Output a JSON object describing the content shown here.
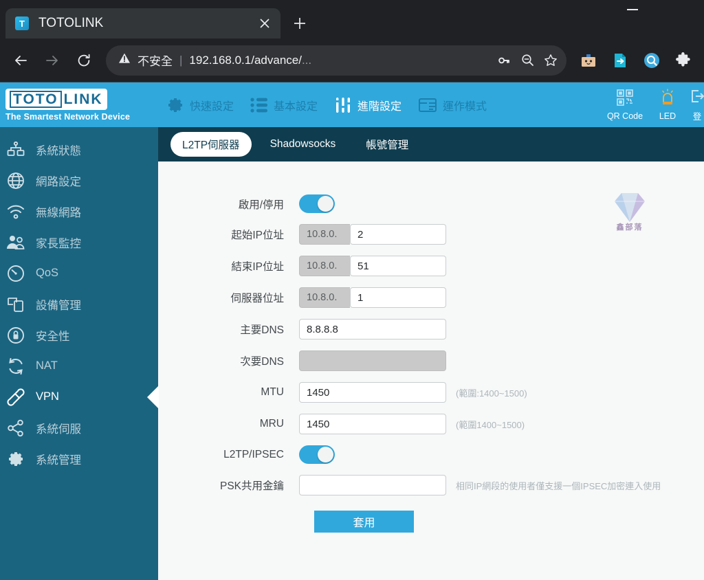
{
  "browser": {
    "tab": {
      "title": "TOTOLINK",
      "favicon": "T",
      "close_icon": "close-icon",
      "newtab_icon": "plus-icon"
    },
    "window": {
      "minimize_icon": "minimize-icon"
    },
    "toolbar": {
      "back_icon": "back-arrow-icon",
      "forward_icon": "forward-arrow-icon",
      "reload_icon": "reload-icon",
      "security_icon": "not-secure-warning-icon",
      "security_label": "不安全",
      "separator": "|",
      "url": "192.168.0.1/advance/",
      "url_tail": "...",
      "password_icon": "key-icon",
      "zoomout_icon": "zoom-out-icon",
      "bookmark_icon": "star-icon",
      "ext_icons": [
        "box-robot-extension-icon",
        "export-extension-icon",
        "search-magnifier-extension-icon",
        "puzzle-extensions-icon"
      ]
    }
  },
  "brand": {
    "logo_toto": "TOTO",
    "logo_link": "LINK",
    "tagline": "The Smartest Network Device"
  },
  "topnav": {
    "items": [
      {
        "label": "快速設定",
        "icon": "gear-icon",
        "active": false
      },
      {
        "label": "基本設定",
        "icon": "list-icon",
        "active": false
      },
      {
        "label": "進階設定",
        "icon": "sliders-icon",
        "active": true
      },
      {
        "label": "運作模式",
        "icon": "mode-window-icon",
        "active": false
      }
    ],
    "right_items": [
      {
        "label": "QR Code",
        "icon": "qr-code-icon"
      },
      {
        "label": "LED",
        "icon": "led-lamp-icon"
      },
      {
        "label": "登",
        "icon": "logout-icon"
      }
    ]
  },
  "sidebar": {
    "items": [
      {
        "label": "系統狀態",
        "icon": "network-status-icon",
        "active": false
      },
      {
        "label": "網路設定",
        "icon": "globe-icon",
        "active": false
      },
      {
        "label": "無線網路",
        "icon": "wifi-icon",
        "active": false
      },
      {
        "label": "家長監控",
        "icon": "parental-control-icon",
        "active": false
      },
      {
        "label": "QoS",
        "icon": "gauge-icon",
        "active": false
      },
      {
        "label": "設備管理",
        "icon": "devices-icon",
        "active": false
      },
      {
        "label": "安全性",
        "icon": "lock-icon",
        "active": false
      },
      {
        "label": "NAT",
        "icon": "refresh-cycle-icon",
        "active": false
      },
      {
        "label": "VPN",
        "icon": "key-chain-icon",
        "active": true
      },
      {
        "label": "系統伺服",
        "icon": "share-nodes-icon",
        "active": false
      },
      {
        "label": "系統管理",
        "icon": "gear-icon",
        "active": false
      }
    ]
  },
  "tabs": [
    {
      "label": "L2TP伺服器",
      "active": true
    },
    {
      "label": "Shadowsocks",
      "active": false
    },
    {
      "label": "帳號管理",
      "active": false
    }
  ],
  "form": {
    "enable": {
      "label": "啟用/停用",
      "state": "on"
    },
    "start_ip": {
      "label": "起始IP位址",
      "prefix": "10.8.0.",
      "value": "2"
    },
    "end_ip": {
      "label": "結束IP位址",
      "prefix": "10.8.0.",
      "value": "51"
    },
    "server_ip": {
      "label": "伺服器位址",
      "prefix": "10.8.0.",
      "value": "1"
    },
    "primary_dns": {
      "label": "主要DNS",
      "value": "8.8.8.8"
    },
    "secondary_dns": {
      "label": "次要DNS",
      "value": "",
      "disabled": true
    },
    "mtu": {
      "label": "MTU",
      "value": "1450",
      "hint": "(範圍:1400~1500)"
    },
    "mru": {
      "label": "MRU",
      "value": "1450",
      "hint": "(範圍1400~1500)"
    },
    "ipsec": {
      "label": "L2TP/IPSEC",
      "state": "on"
    },
    "psk": {
      "label": "PSK共用金鑰",
      "value": "",
      "placeholder": "",
      "hint": "相同IP網段的使用者僅支援一個IPSEC加密連入使用"
    },
    "apply_label": "套用"
  },
  "watermark": {
    "text": "鑫部落"
  },
  "colors": {
    "brand_blue": "#30a8dc",
    "sidebar_blue": "#1b6480",
    "tabbar_dark": "#0f3d4f",
    "chrome_dark": "#202124"
  }
}
